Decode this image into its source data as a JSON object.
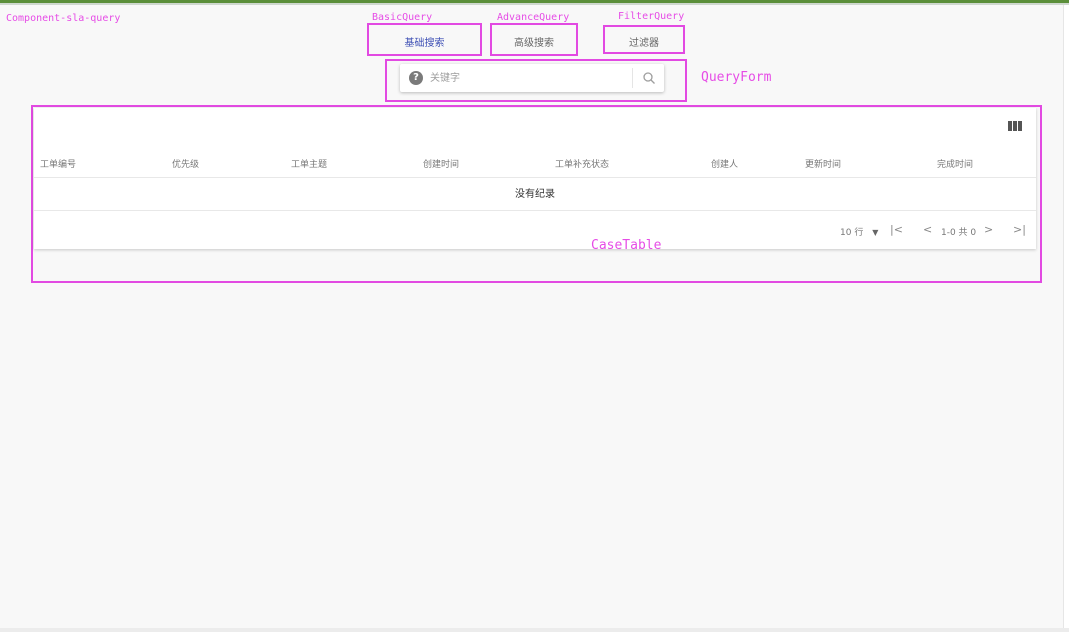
{
  "annotations": {
    "component": "Component-sla-query",
    "basic_query": "BasicQuery",
    "advance_query": "AdvanceQuery",
    "filter_query": "FilterQuery",
    "query_form": "QueryForm",
    "case_table": "CaseTable"
  },
  "tabs": {
    "basic": "基础搜索",
    "advance": "高级搜索",
    "filter": "过滤器",
    "active": "basic"
  },
  "search": {
    "placeholder": "关键字",
    "value": "",
    "help_icon": "question-circle-icon",
    "search_icon": "magnifier-icon"
  },
  "table": {
    "columns_icon": "view-column-icon",
    "headers": [
      "工单编号",
      "优先级",
      "工单主题",
      "创建时间",
      "工单补充状态",
      "创建人",
      "更新时间",
      "完成时间"
    ],
    "empty_text": "没有纪录",
    "pagination": {
      "rows_per_page": "10 行",
      "range": "1-0 共 0",
      "first_icon": "first-page-icon",
      "prev_icon": "chevron-left-icon",
      "next_icon": "chevron-right-icon",
      "last_icon": "last-page-icon"
    }
  },
  "colors": {
    "annotation": "#e24ae2",
    "active_tab": "#3f51b5",
    "top_bar": "#5b8f3a"
  }
}
